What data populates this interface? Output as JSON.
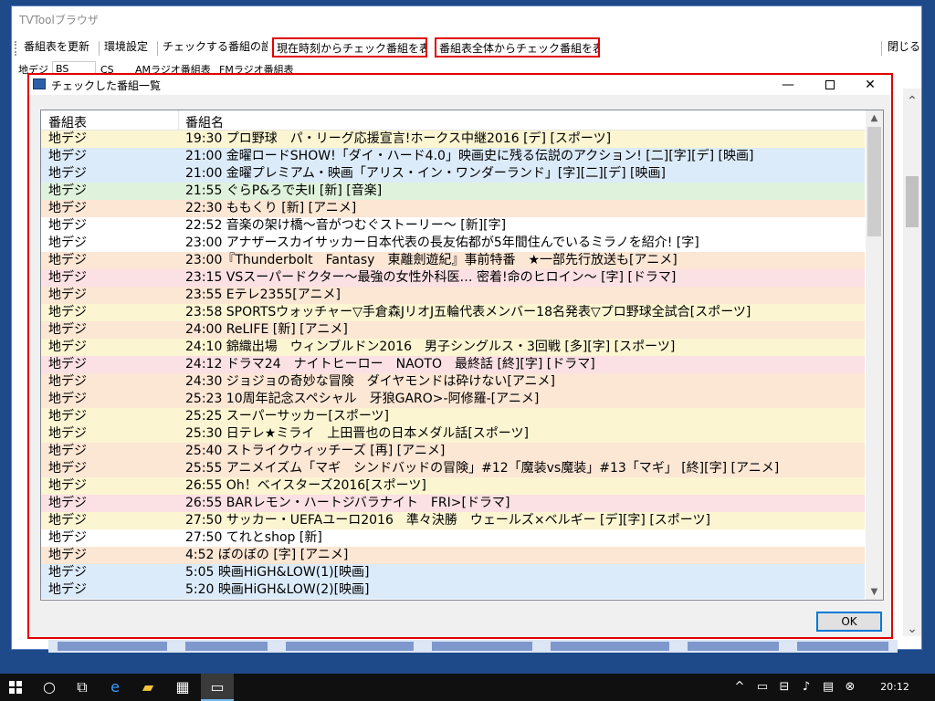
{
  "main_window": {
    "title": "TVToolブラウザ",
    "toolbar": {
      "refresh": "番組表を更新",
      "settings": "環境設定",
      "check_settings": "チェックする番組の設定",
      "show_from_now": "現在時刻からチェック番組を表示",
      "show_all": "番組表全体からチェック番組を表示",
      "close": "閉じる"
    },
    "tabs": [
      "地デジ",
      "BS",
      "CS",
      "AMラジオ番組表",
      "FMラジオ番組表"
    ]
  },
  "dialog": {
    "title": "チェックした番組一覧",
    "minimize": "—",
    "close": "✕",
    "columns": {
      "channel": "番組表",
      "program": "番組名"
    },
    "rows": [
      {
        "channel": "地デジ",
        "program": "19:30 プロ野球　パ・リーグ応援宣言!ホークス中継2016 [デ] [スポーツ]",
        "color": "#fbf5d2"
      },
      {
        "channel": "地デジ",
        "program": "21:00 金曜ロードSHOW!「ダイ・ハード4.0」映画史に残る伝説のアクション! [二][字][デ] [映画]",
        "color": "#dcebf9"
      },
      {
        "channel": "地デジ",
        "program": "21:00 金曜プレミアム・映画「アリス・イン・ワンダーランド」[字][二][デ] [映画]",
        "color": "#dcebf9"
      },
      {
        "channel": "地デジ",
        "program": "21:55 ぐらP&ろで夫II [新] [音楽]",
        "color": "#dff3dc"
      },
      {
        "channel": "地デジ",
        "program": "22:30 ももくり [新] [アニメ]",
        "color": "#fce6d4"
      },
      {
        "channel": "地デジ",
        "program": "22:52 音楽の架け橋～音がつむぐストーリー～ [新][字]",
        "color": "#ffffff"
      },
      {
        "channel": "地デジ",
        "program": "23:00 アナザースカイサッカー日本代表の長友佑都が5年間住んでいるミラノを紹介! [字]",
        "color": "#ffffff"
      },
      {
        "channel": "地デジ",
        "program": "23:00『Thunderbolt　Fantasy　東離劍遊紀』事前特番　★一部先行放送も[アニメ]",
        "color": "#fce6d4"
      },
      {
        "channel": "地デジ",
        "program": "23:15 VSスーパードクター～最強の女性外科医… 密着!命のヒロイン～ [字] [ドラマ]",
        "color": "#fbe0e4"
      },
      {
        "channel": "地デジ",
        "program": "23:55 Eテレ2355[アニメ]",
        "color": "#fce6d4"
      },
      {
        "channel": "地デジ",
        "program": "23:58 SPORTSウォッチャー▽手倉森JリオJ五輪代表メンバー18名発表▽プロ野球全試合[スポーツ]",
        "color": "#fbf5d2"
      },
      {
        "channel": "地デジ",
        "program": "24:00 ReLIFE [新] [アニメ]",
        "color": "#fce6d4"
      },
      {
        "channel": "地デジ",
        "program": "24:10 錦織出場　ウィンブルドン2016　男子シングルス・3回戦 [多][字] [スポーツ]",
        "color": "#fbf5d2"
      },
      {
        "channel": "地デジ",
        "program": "24:12 ドラマ24　ナイトヒーロー　NAOTO　最終話 [終][字] [ドラマ]",
        "color": "#fbe0e4"
      },
      {
        "channel": "地デジ",
        "program": "24:30 ジョジョの奇妙な冒険　ダイヤモンドは砕けない[アニメ]",
        "color": "#fce6d4"
      },
      {
        "channel": "地デジ",
        "program": "25:23 10周年記念スペシャル　牙狼GARO>-阿修羅-[アニメ]",
        "color": "#fce6d4"
      },
      {
        "channel": "地デジ",
        "program": "25:25 スーパーサッカー[スポーツ]",
        "color": "#fbf5d2"
      },
      {
        "channel": "地デジ",
        "program": "25:30 日テレ★ミライ　上田晋也の日本メダル話[スポーツ]",
        "color": "#fbf5d2"
      },
      {
        "channel": "地デジ",
        "program": "25:40 ストライクウィッチーズ [再] [アニメ]",
        "color": "#fce6d4"
      },
      {
        "channel": "地デジ",
        "program": "25:55 アニメイズム「マギ　シンドバッドの冒険」#12「魔装vs魔装」#13「マギ」 [終][字] [アニメ]",
        "color": "#fce6d4"
      },
      {
        "channel": "地デジ",
        "program": "26:55 Oh！ベイスターズ2016[スポーツ]",
        "color": "#fbf5d2"
      },
      {
        "channel": "地デジ",
        "program": "26:55 BARレモン・ハートジバラナイト　FRI>[ドラマ]",
        "color": "#fbe0e4"
      },
      {
        "channel": "地デジ",
        "program": "27:50 サッカー・UEFAユーロ2016　準々決勝　ウェールズ×ベルギー [デ][字] [スポーツ]",
        "color": "#fbf5d2"
      },
      {
        "channel": "地デジ",
        "program": "27:50 てれとshop [新]",
        "color": "#ffffff"
      },
      {
        "channel": "地デジ",
        "program": "4:52 ぼのぼの [字] [アニメ]",
        "color": "#fce6d4"
      },
      {
        "channel": "地デジ",
        "program": "5:05 映画HiGH&LOW(1)[映画]",
        "color": "#dcebf9"
      },
      {
        "channel": "地デジ",
        "program": "5:20 映画HiGH&LOW(2)[映画]",
        "color": "#dcebf9"
      }
    ],
    "ok": "OK"
  },
  "taskbar": {
    "clock": "20:12",
    "icons": [
      "start-icon",
      "cortana-icon",
      "task-view-icon",
      "edge-icon",
      "file-explorer-icon",
      "store-icon",
      "tvtool-icon"
    ],
    "tray": [
      "chevron-up-icon",
      "display-icon",
      "network-icon",
      "volume-icon",
      "notification-icon"
    ]
  },
  "colors": {
    "highlight_border": "#e00000",
    "taskbar": "#101010",
    "accent": "#0078d7"
  }
}
